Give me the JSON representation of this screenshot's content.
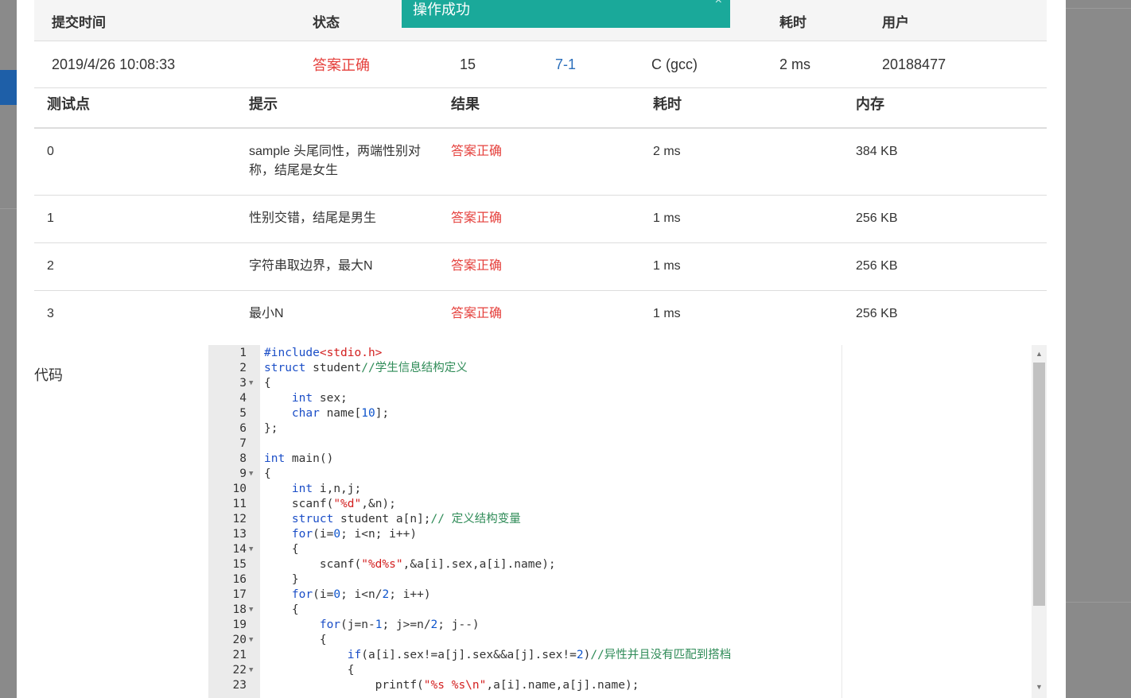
{
  "toast": {
    "message": "操作成功",
    "close": "×"
  },
  "submission": {
    "headers": [
      "提交时间",
      "状态",
      "",
      "",
      "",
      "耗时",
      "用户"
    ],
    "row": [
      "2019/4/26 10:08:33",
      "答案正确",
      "15",
      "7-1",
      "C (gcc)",
      "2 ms",
      "20188477"
    ]
  },
  "cases": {
    "headers": [
      "测试点",
      "提示",
      "结果",
      "耗时",
      "内存"
    ],
    "rows": [
      [
        "0",
        "sample 头尾同性，两端性别对称，结尾是女生",
        "答案正确",
        "2 ms",
        "384 KB"
      ],
      [
        "1",
        "性别交错，结尾是男生",
        "答案正确",
        "1 ms",
        "256 KB"
      ],
      [
        "2",
        "字符串取边界，最大N",
        "答案正确",
        "1 ms",
        "256 KB"
      ],
      [
        "3",
        "最小N",
        "答案正确",
        "1 ms",
        "256 KB"
      ]
    ]
  },
  "code_label": "代码",
  "code_lines": [
    {
      "n": "1",
      "fold": false,
      "text": "#include<stdio.h>"
    },
    {
      "n": "2",
      "fold": false,
      "text": "struct student//学生信息结构定义"
    },
    {
      "n": "3",
      "fold": true,
      "text": "{"
    },
    {
      "n": "4",
      "fold": false,
      "text": "    int sex;"
    },
    {
      "n": "5",
      "fold": false,
      "text": "    char name[10];"
    },
    {
      "n": "6",
      "fold": false,
      "text": "};"
    },
    {
      "n": "7",
      "fold": false,
      "text": ""
    },
    {
      "n": "8",
      "fold": false,
      "text": "int main()"
    },
    {
      "n": "9",
      "fold": true,
      "text": "{"
    },
    {
      "n": "10",
      "fold": false,
      "text": "    int i,n,j;"
    },
    {
      "n": "11",
      "fold": false,
      "text": "    scanf(\"%d\",&n);"
    },
    {
      "n": "12",
      "fold": false,
      "text": "    struct student a[n];// 定义结构变量"
    },
    {
      "n": "13",
      "fold": false,
      "text": "    for(i=0; i<n; i++)"
    },
    {
      "n": "14",
      "fold": true,
      "text": "    {"
    },
    {
      "n": "15",
      "fold": false,
      "text": "        scanf(\"%d%s\",&a[i].sex,a[i].name);"
    },
    {
      "n": "16",
      "fold": false,
      "text": "    }"
    },
    {
      "n": "17",
      "fold": false,
      "text": "    for(i=0; i<n/2; i++)"
    },
    {
      "n": "18",
      "fold": true,
      "text": "    {"
    },
    {
      "n": "19",
      "fold": false,
      "text": "        for(j=n-1; j>=n/2; j--)"
    },
    {
      "n": "20",
      "fold": true,
      "text": "        {"
    },
    {
      "n": "21",
      "fold": false,
      "text": "            if(a[i].sex!=a[j].sex&&a[j].sex!=2)//异性并且没有匹配到搭档"
    },
    {
      "n": "22",
      "fold": true,
      "text": "            {"
    },
    {
      "n": "23",
      "fold": false,
      "text": "                printf(\"%s %s\\n\",a[i].name,a[j].name);"
    }
  ],
  "colors": {
    "toast_bg": "#1aa99a",
    "status_ok": "#e5403c",
    "link": "#2a6ebb",
    "keyword": "#1b4ec7",
    "comment": "#2e8b57"
  }
}
